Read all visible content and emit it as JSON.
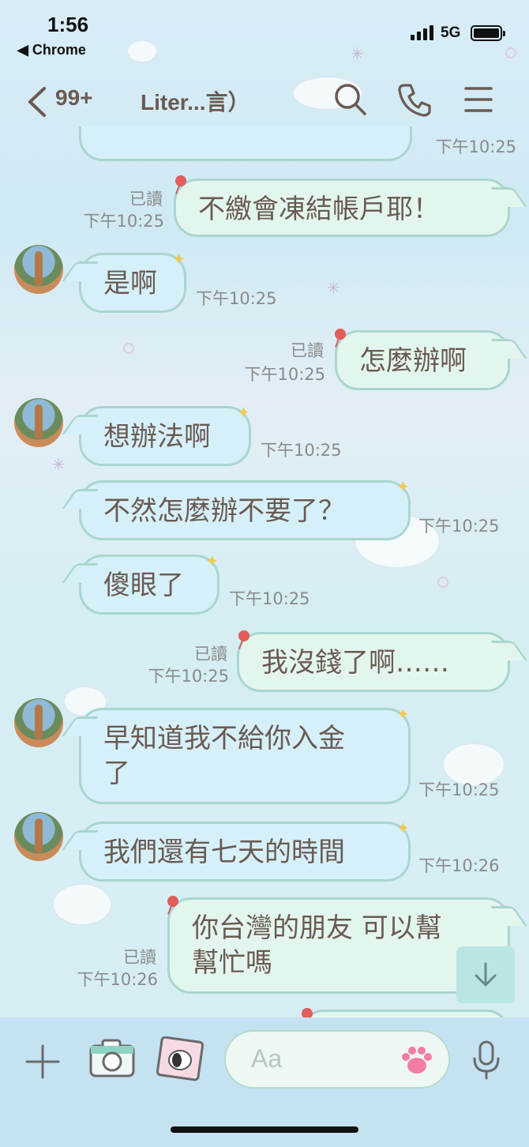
{
  "status_bar": {
    "time": "1:56",
    "back_app": "◀ Chrome",
    "network": "5G"
  },
  "header": {
    "unread_count": "99+",
    "title": "Liter...言）"
  },
  "messages": [
    {
      "side": "out",
      "text": "不繳會凍結帳戶耶！",
      "read": "已讀",
      "time": "下午10:25"
    },
    {
      "side": "in",
      "text": "是啊",
      "time": "下午10:25"
    },
    {
      "side": "out",
      "text": "怎麼辦啊",
      "read": "已讀",
      "time": "下午10:25"
    },
    {
      "side": "in",
      "text": "想辦法啊",
      "time": "下午10:25"
    },
    {
      "side": "in",
      "text": "不然怎麼辦不要了？",
      "time": "下午10:25"
    },
    {
      "side": "in",
      "text": "傻眼了",
      "time": "下午10:25"
    },
    {
      "side": "out",
      "text": "我沒錢了啊……",
      "read": "已讀",
      "time": "下午10:25"
    },
    {
      "side": "in",
      "text_line1": "早知道我不給你入金",
      "text_line2": "了",
      "time": "下午10:25"
    },
    {
      "side": "in",
      "text": "我們還有七天的時間",
      "time": "下午10:26"
    },
    {
      "side": "out",
      "text_line1": "你台灣的朋友 可以幫",
      "text_line2": "幫忙嗎",
      "read": "已讀",
      "time": "下午10:26"
    }
  ],
  "top_partial": {
    "time": "下午10:25"
  },
  "input": {
    "placeholder": "Aa"
  },
  "colors": {
    "bubble_in": "#d6f0fa",
    "bubble_out": "#e3f6ee",
    "bubble_border": "#a9d6cf",
    "input_bar": "#c4e2f1"
  }
}
